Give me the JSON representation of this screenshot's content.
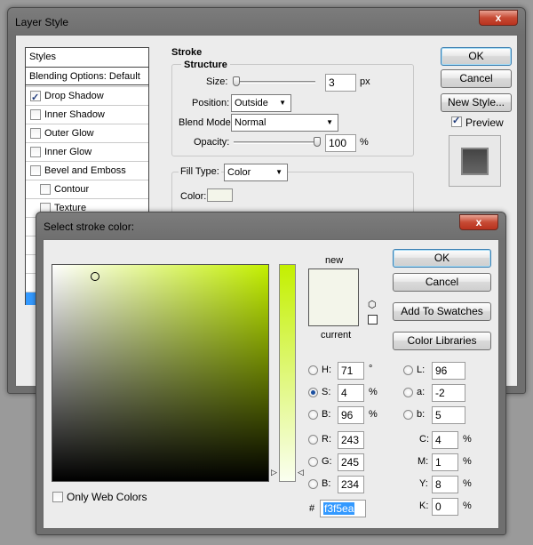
{
  "layer_style": {
    "title": "Layer Style",
    "close_glyph": "x",
    "styles_header": "Styles",
    "styles_items": [
      "Blending Options: Default",
      "Drop Shadow",
      "Inner Shadow",
      "Outer Glow",
      "Inner Glow",
      "Bevel and Emboss",
      "Contour",
      "Texture"
    ],
    "stroke_heading": "Stroke",
    "structure_heading": "Structure",
    "size_label": "Size:",
    "size_value": "3",
    "size_unit": "px",
    "position_label": "Position:",
    "position_value": "Outside",
    "blend_mode_label": "Blend Mode:",
    "blend_mode_value": "Normal",
    "opacity_label": "Opacity:",
    "opacity_value": "100",
    "opacity_unit": "%",
    "fill_type_label": "Fill Type:",
    "fill_type_value": "Color",
    "color_label": "Color:",
    "ok": "OK",
    "cancel": "Cancel",
    "new_style": "New Style...",
    "preview_label": "Preview"
  },
  "picker": {
    "title": "Select stroke color:",
    "close_glyph": "x",
    "ok": "OK",
    "cancel": "Cancel",
    "add_to_swatches": "Add To Swatches",
    "color_libraries": "Color Libraries",
    "new_label": "new",
    "current_label": "current",
    "only_web_colors": "Only Web Colors",
    "hue_value": 71,
    "h_label": "H:",
    "h_value": "71",
    "h_unit": "°",
    "s_label": "S:",
    "s_value": "4",
    "s_unit": "%",
    "b_label": "B:",
    "b_value": "96",
    "b_unit": "%",
    "r_label": "R:",
    "r_value": "243",
    "g_label": "G:",
    "g_value": "245",
    "bb_label": "B:",
    "bb_value": "234",
    "l_label": "L:",
    "l_value": "96",
    "a_label": "a:",
    "a_value": "-2",
    "lb_label": "b:",
    "lb_value": "5",
    "c_label": "C:",
    "c_value": "4",
    "c_unit": "%",
    "m_label": "M:",
    "m_value": "1",
    "m_unit": "%",
    "y_label": "Y:",
    "y_value": "8",
    "y_unit": "%",
    "k_label": "K:",
    "k_value": "0",
    "k_unit": "%",
    "hash_label": "#",
    "hex_value": "f3f5ea"
  },
  "colors": {
    "selected_color": "#f3f5ea",
    "hue_color": "#ccf000",
    "highlight": "#3399ff"
  }
}
